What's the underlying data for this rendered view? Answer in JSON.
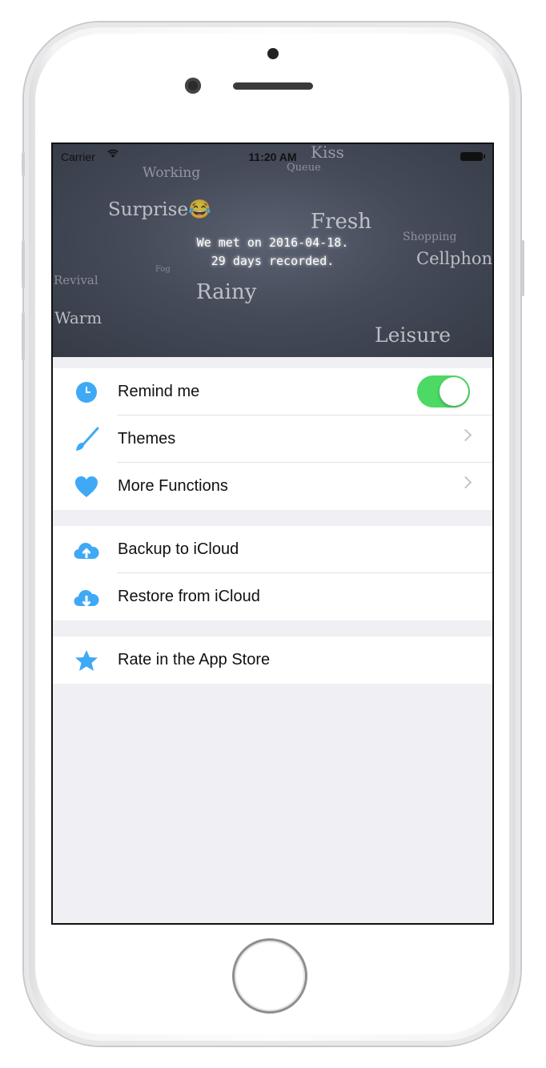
{
  "status_bar": {
    "carrier": "Carrier",
    "time": "11:20 AM"
  },
  "header": {
    "message_line1": "We met on 2016-04-18.",
    "message_line2": "29 days recorded.",
    "words": [
      "Kiss",
      "Queue",
      "Working",
      "Surprise😂",
      "Fresh",
      "Shopping",
      "Cellphon",
      "Fog",
      "Revival",
      "Rainy",
      "Warm",
      "Leisure"
    ]
  },
  "settings": {
    "group1": [
      {
        "label": "Remind me",
        "icon": "clock-icon",
        "toggle_on": true
      },
      {
        "label": "Themes",
        "icon": "brush-icon"
      },
      {
        "label": "More Functions",
        "icon": "heart-icon"
      }
    ],
    "group2": [
      {
        "label": "Backup to iCloud",
        "icon": "cloud-upload-icon"
      },
      {
        "label": "Restore from iCloud",
        "icon": "cloud-download-icon"
      }
    ],
    "group3": [
      {
        "label": "Rate in the App Store",
        "icon": "star-icon"
      }
    ]
  },
  "colors": {
    "accent": "#3fa9f5",
    "toggle_on": "#4cd964",
    "background": "#efeff4"
  }
}
